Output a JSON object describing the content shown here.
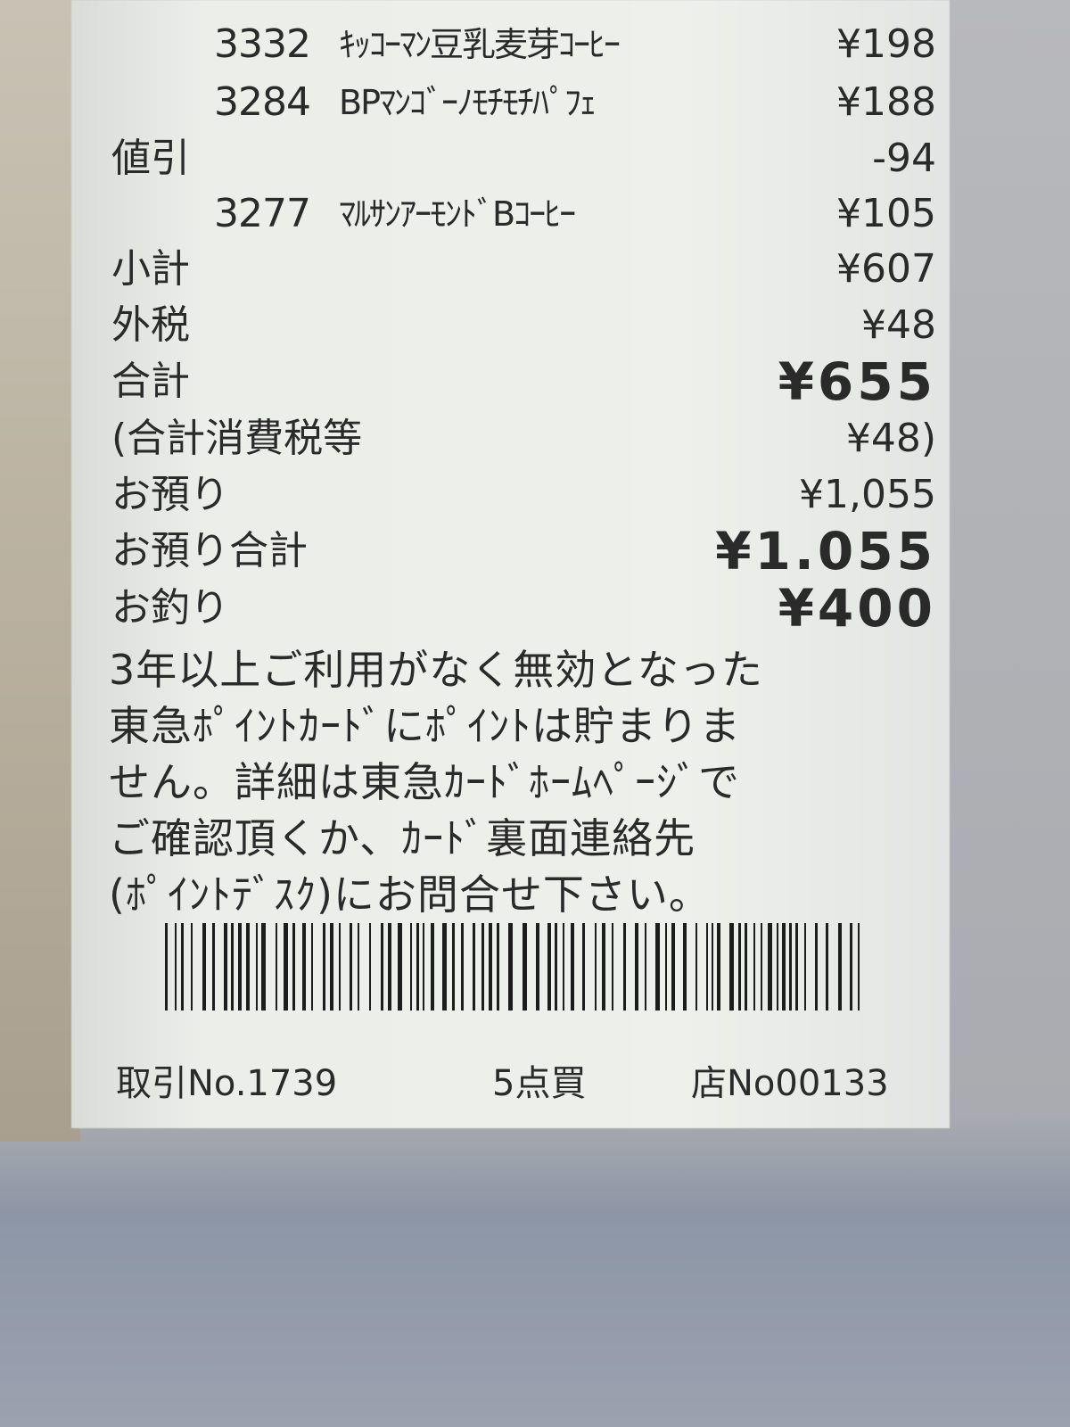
{
  "items": [
    {
      "code": "3332",
      "name": "ｷｯｺｰﾏﾝ豆乳麦芽ｺｰﾋｰ",
      "price": "¥198"
    },
    {
      "code": "3284",
      "name": "BPﾏﾝｺﾞｰﾉﾓﾁﾓﾁﾊﾟﾌｪ",
      "price": "¥188"
    },
    {
      "label": "値引",
      "price": "-94"
    },
    {
      "code": "3277",
      "name": "ﾏﾙｻﾝｱｰﾓﾝﾄﾞBｺｰﾋｰ",
      "price": "¥105"
    }
  ],
  "totals": {
    "subtotal_label": "小計",
    "subtotal": "¥607",
    "tax_label": "外税",
    "tax": "¥48",
    "total_label": "合計",
    "total": "¥655",
    "tax_total_label": "(合計消費税等",
    "tax_total": "¥48)",
    "deposit_label": "お預り",
    "deposit": "¥1,055",
    "deposit_total_label": "お預り合計",
    "deposit_total": "¥1.055",
    "change_label": "お釣り",
    "change": "¥400"
  },
  "notice": [
    "3年以上ご利用がなく無効となった",
    "東急ﾎﾟｲﾝﾄｶｰﾄﾞにﾎﾟｲﾝﾄは貯まりま",
    "せん。詳細は東急ｶｰﾄﾞﾎｰﾑﾍﾟｰｼﾞで",
    "ご確認頂くか、ｶｰﾄﾞ裏面連絡先",
    "(ﾎﾟｲﾝﾄﾃﾞｽｸ)にお問合せ下さい。"
  ],
  "footer": {
    "transaction": "取引No.1739",
    "count": "5点買",
    "store": "店No00133"
  }
}
